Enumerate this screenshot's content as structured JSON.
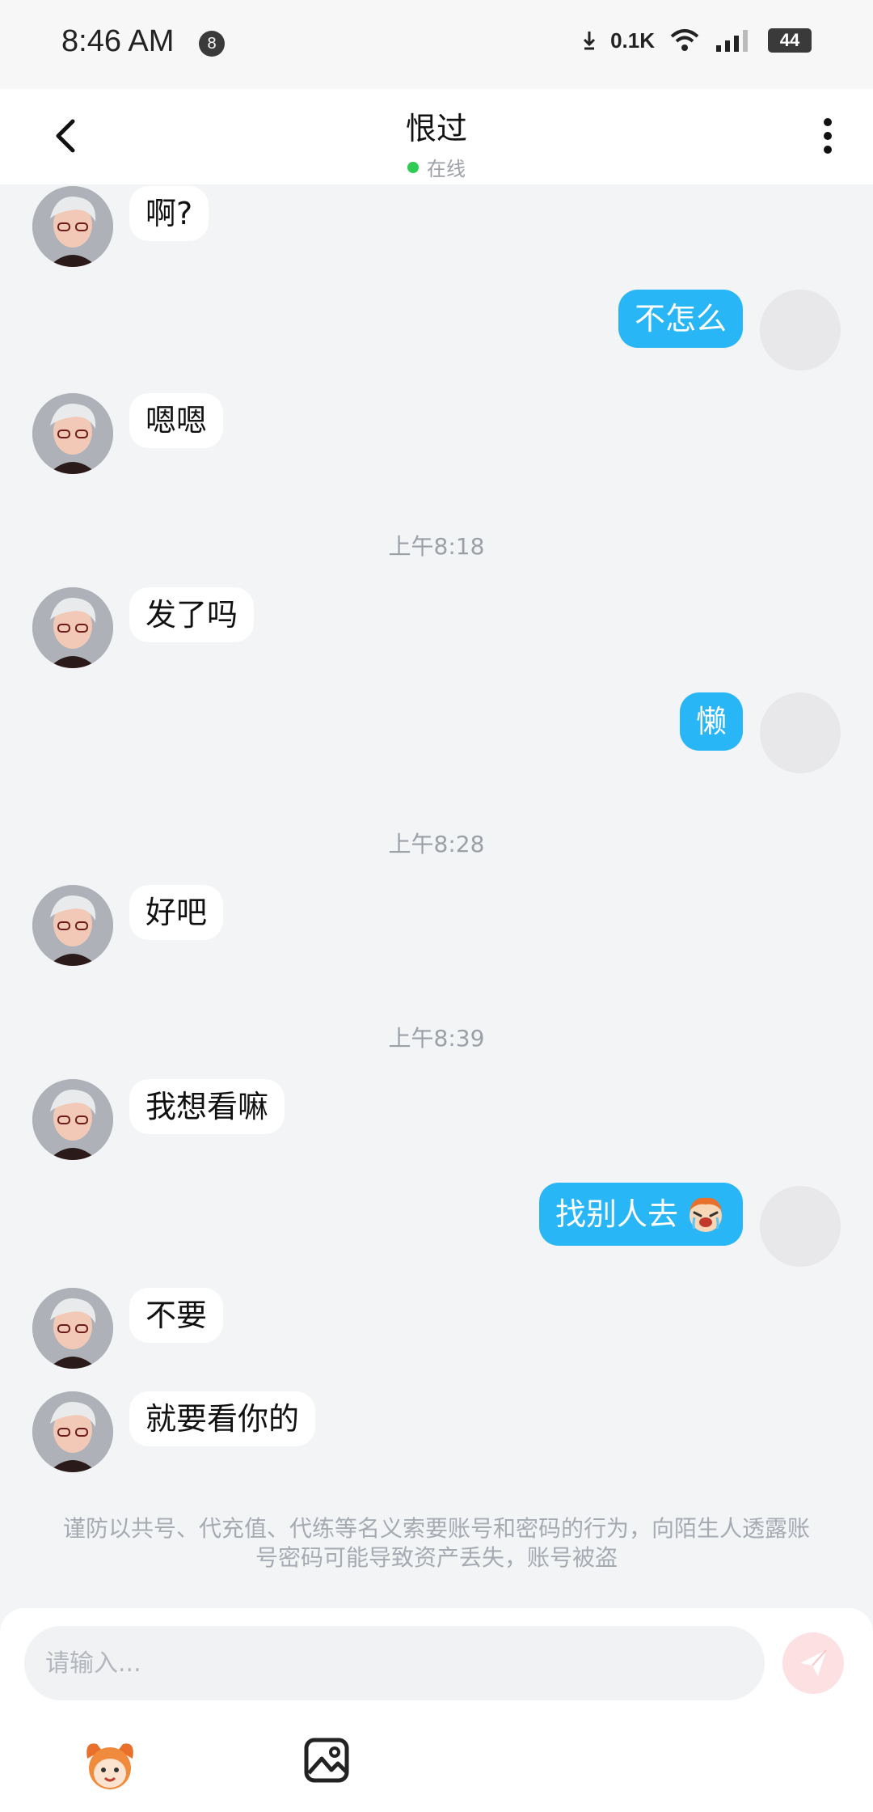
{
  "status_bar": {
    "time": "8:46 AM",
    "notification_count": "8",
    "net_speed": "0.1K",
    "battery": "44"
  },
  "header": {
    "title": "恨过",
    "status": "在线",
    "status_color": "#2ecc55"
  },
  "messages": [
    {
      "side": "in",
      "text": "啊?"
    },
    {
      "side": "out",
      "text": "不怎么"
    },
    {
      "side": "in",
      "text": "嗯嗯"
    },
    {
      "time": "上午8:18"
    },
    {
      "side": "in",
      "text": "发了吗"
    },
    {
      "side": "out",
      "text": "懒"
    },
    {
      "time": "上午8:28"
    },
    {
      "side": "in",
      "text": "好吧"
    },
    {
      "time": "上午8:39"
    },
    {
      "side": "in",
      "text": "我想看嘛"
    },
    {
      "side": "out",
      "text": "找别人去",
      "emoji": "crying-face-sticker"
    },
    {
      "side": "in",
      "text": "不要"
    },
    {
      "side": "in",
      "text": "就要看你的"
    }
  ],
  "notice": "谨防以共号、代充值、代练等名义索要账号和密码的行为，向陌生人透露账号密码可能导致资产丢失，账号被盗",
  "composer": {
    "placeholder": "请输入...",
    "send_icon": "send-icon",
    "toolbar_icons": [
      "emoji-mascot-icon",
      "image-icon"
    ]
  },
  "colors": {
    "outgoing_bubble": "#29b6f6",
    "incoming_bubble": "#ffffff",
    "background": "#f3f4f6",
    "send_button": "#fde1e2"
  }
}
